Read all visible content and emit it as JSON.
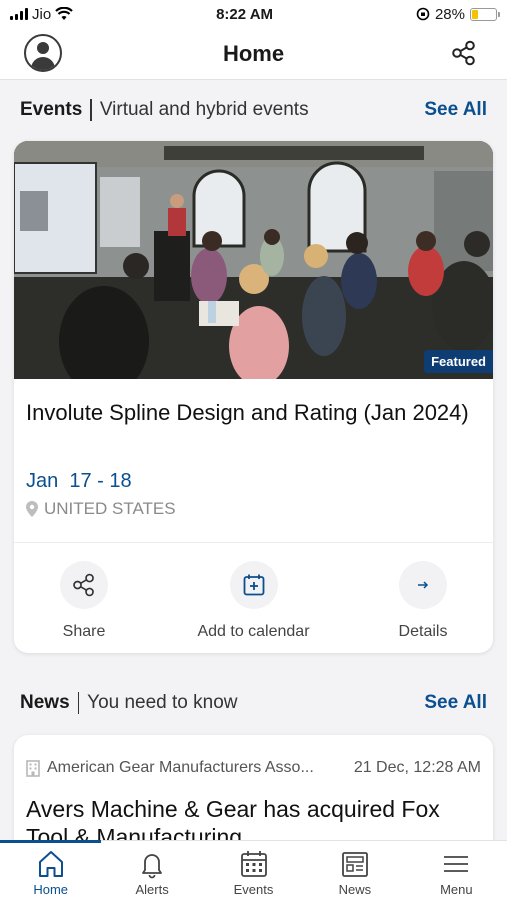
{
  "status_bar": {
    "carrier": "Jio",
    "time": "8:22 AM",
    "battery_percent": "28%",
    "battery_level": 0.28
  },
  "header": {
    "title": "Home"
  },
  "events_section": {
    "title": "Events",
    "subtitle": "Virtual and hybrid events",
    "see_all": "See All",
    "card": {
      "badge": "Featured",
      "title": "Involute Spline Design and Rating (Jan 2024)",
      "date": "Jan  17 - 18",
      "location": "UNITED STATES",
      "actions": {
        "share": "Share",
        "calendar": "Add to calendar",
        "details": "Details"
      }
    }
  },
  "news_section": {
    "title": "News",
    "subtitle": "You need to know",
    "see_all": "See All",
    "card": {
      "source": "American Gear Manufacturers Asso...",
      "timestamp": "21 Dec, 12:28 AM",
      "title": "Avers Machine & Gear has acquired Fox Tool & Manufacturing"
    }
  },
  "tab_bar": {
    "home": "Home",
    "alerts": "Alerts",
    "events": "Events",
    "news": "News",
    "menu": "Menu"
  },
  "colors": {
    "accent": "#0b4f8f",
    "badge": "#0e3d73",
    "battery": "#f5c400"
  }
}
